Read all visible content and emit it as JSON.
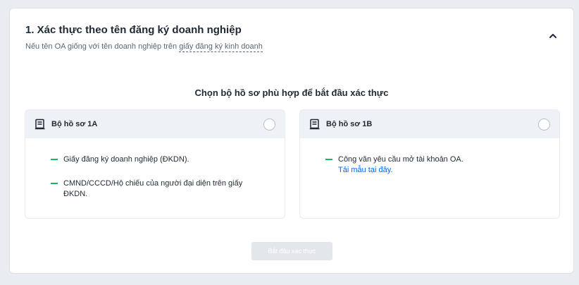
{
  "section": {
    "title": "1. Xác thực theo tên đăng ký doanh nghiệp",
    "subtitle_prefix": "Nếu tên OA giống với tên doanh nghiệp trên ",
    "subtitle_link": "giấy đăng ký kinh doanh",
    "collapse_icon": "chevron-up-icon"
  },
  "picker": {
    "title": "Chọn bộ hồ sơ phù hợp để bắt đầu xác thực"
  },
  "cards": [
    {
      "name": "Bộ hồ sơ 1A",
      "icon": "document-icon",
      "selected": false,
      "requirements": [
        "Giấy đăng ký doanh nghiệp (ĐKDN).",
        "CMND/CCCD/Hộ chiếu của người đại diện trên giấy ĐKDN."
      ]
    },
    {
      "name": "Bộ hồ sơ 1B",
      "icon": "document-icon",
      "selected": false,
      "requirements": [
        "Công văn yêu cầu mở tài khoản OA."
      ],
      "template_link": "Tải mẫu tại đây."
    }
  ],
  "start_button": {
    "label": "Bắt đầu xác thực",
    "disabled": true
  },
  "colors": {
    "accent_green": "#1fb35c",
    "link_blue": "#0068ff",
    "card_header_bg": "#eef1f5",
    "disabled_button_bg": "#e3e6ea"
  }
}
